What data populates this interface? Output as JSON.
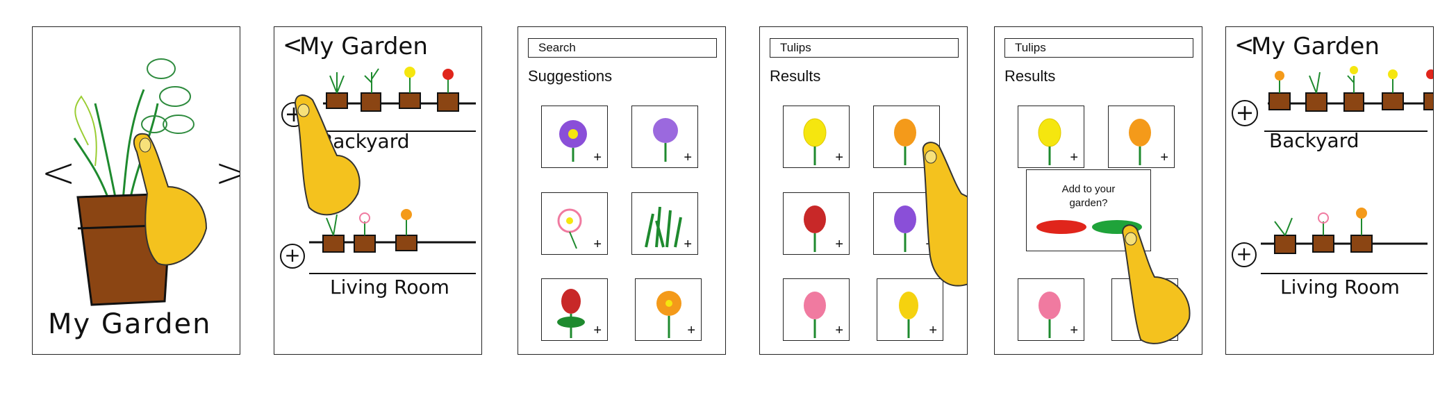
{
  "screen1": {
    "title": "My Garden",
    "prev_glyph": "<",
    "next_glyph": ">"
  },
  "screen2": {
    "back_glyph": "<",
    "title": "My Garden",
    "add_glyph": "+",
    "rooms": [
      {
        "label": "Backyard"
      },
      {
        "label": "Living Room"
      }
    ]
  },
  "screen3": {
    "search_placeholder": "Search",
    "section_title": "Suggestions",
    "add_glyph": "+"
  },
  "screen4": {
    "search_value": "Tulips",
    "section_title": "Results",
    "add_glyph": "+"
  },
  "screen5": {
    "search_value": "Tulips",
    "section_title": "Results",
    "add_glyph": "+",
    "dialog_message": "Add to your garden?"
  },
  "screen6": {
    "back_glyph": "<",
    "title": "My Garden",
    "add_glyph": "+",
    "rooms": [
      {
        "label": "Backyard"
      },
      {
        "label": "Living Room"
      }
    ]
  },
  "colors": {
    "pot": "#8B4513",
    "hand": "#F4C21E",
    "leaf": "#1E8A2E",
    "cancel": "#E0251B",
    "confirm": "#1FA33A"
  }
}
